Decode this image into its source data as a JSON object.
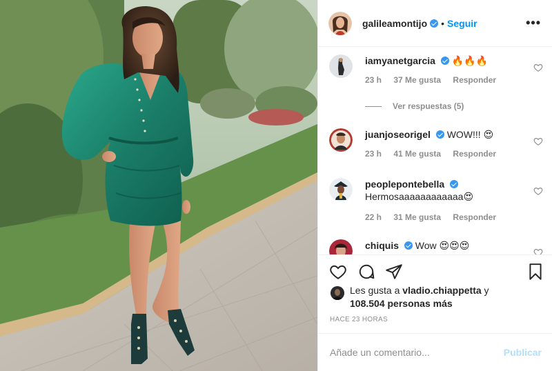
{
  "post": {
    "author": "galileamontijo",
    "follow_label": "Seguir",
    "separator": "•",
    "more_label": "•••"
  },
  "comments": [
    {
      "user": "iamyanetgarcia",
      "text": "🔥🔥🔥",
      "time": "23 h",
      "likes": "37 Me gusta",
      "reply": "Responder",
      "verified": true
    },
    {
      "user": "juanjoseorigel",
      "text": "WOW!!! 😍",
      "time": "23 h",
      "likes": "41 Me gusta",
      "reply": "Responder",
      "verified": true
    },
    {
      "user": "peoplepontebella",
      "text": "Hermosaaaaaaaaaaaa😍",
      "time": "22 h",
      "likes": "31 Me gusta",
      "reply": "Responder",
      "verified": true
    },
    {
      "user": "chiquis",
      "text": "Wow 😍😍😍",
      "verified": true
    }
  ],
  "view_replies": "Ver respuestas (5)",
  "actions": {
    "like_icon": "heart-icon",
    "comment_icon": "comment-icon",
    "share_icon": "paper-plane-icon",
    "save_icon": "bookmark-icon"
  },
  "likes": {
    "prefix": "Les gusta a ",
    "user": "vladio.chiappetta",
    "connector": " y",
    "count": "108.504 personas más"
  },
  "timestamp": "HACE 23 HORAS",
  "add_comment": {
    "placeholder": "Añade un comentario...",
    "publish_label": "Publicar"
  },
  "colors": {
    "accent": "#0095f6",
    "publish_disabled": "#b2dffc",
    "verified": "#3897f0",
    "muted": "#8e8e8e",
    "dress": "#1f8a73"
  }
}
